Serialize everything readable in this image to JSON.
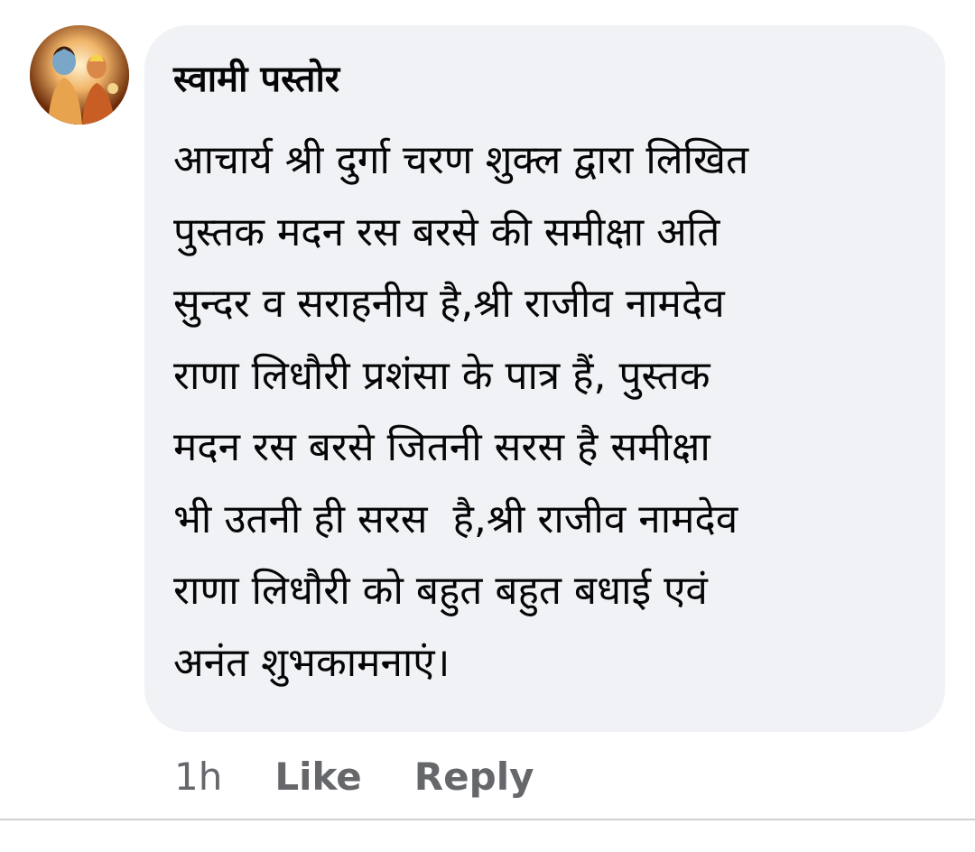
{
  "comment": {
    "author": "स्वामी पस्तोर",
    "avatar_icon": "profile-picture-avatar",
    "text_lines": [
      "आचार्य श्री दुर्गा चरण शुक्ल द्वारा लिखित",
      "पुस्तक मदन रस बरसे की समीक्षा अति",
      "सुन्दर व सराहनीय है,श्री राजीव नामदेव",
      "राणा लिधौरी प्रशंसा के पात्र हैं, पुस्तक",
      "मदन रस बरसे जितनी सरस है समीक्षा",
      "भी उतनी ही सरस  है,श्री राजीव नामदेव",
      "राणा लिधौरी को बहुत बहुत बधाई एवं",
      "अनंत शुभकामनाएं।"
    ],
    "time": "1h",
    "like_label": "Like",
    "reply_label": "Reply"
  },
  "colors": {
    "bubble_bg": "#f0f2f5",
    "text": "#050505",
    "meta": "#65676b"
  }
}
